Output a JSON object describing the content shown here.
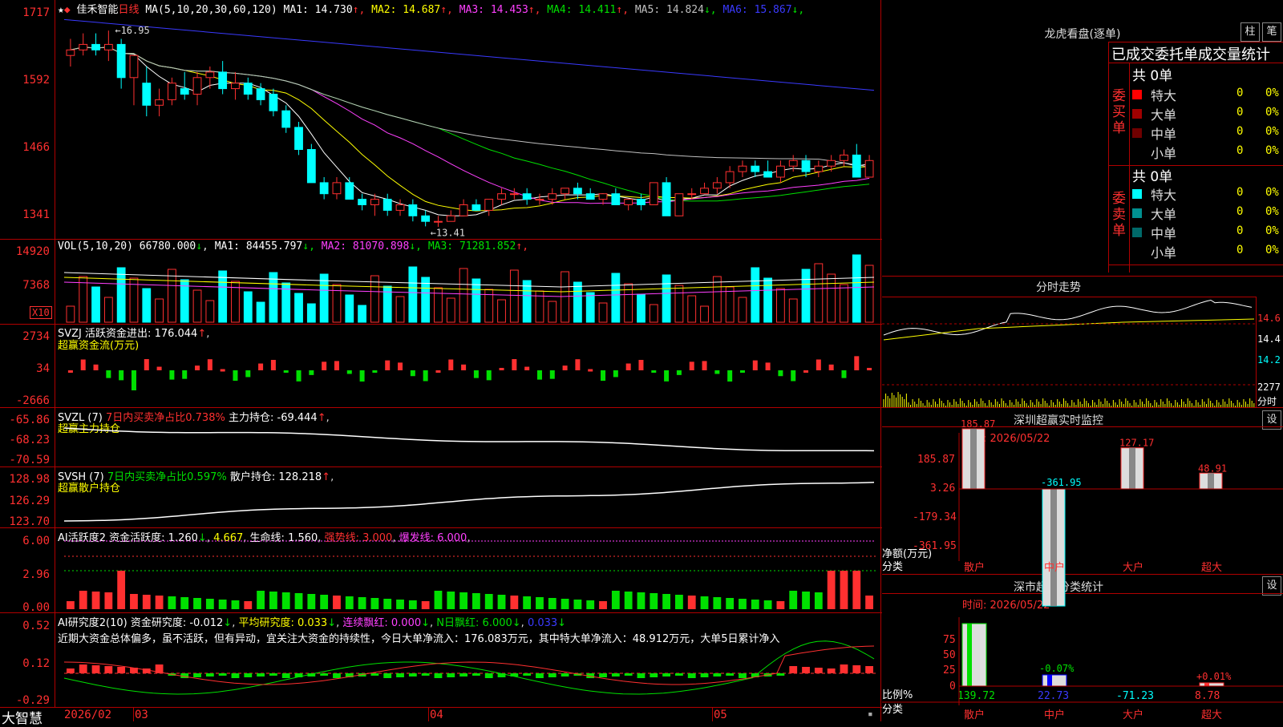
{
  "stock": {
    "name": "佳禾智能",
    "period": "日线",
    "ma_params": "MA(5,10,20,30,60,120)",
    "ma_values": [
      {
        "label": "MA1:",
        "value": "14.730",
        "arrow": "↑",
        "color": "#ffffff"
      },
      {
        "label": "MA2:",
        "value": "14.687",
        "arrow": "↑",
        "color": "#ffff00"
      },
      {
        "label": "MA3:",
        "value": "14.453",
        "arrow": "↑",
        "color": "#ff40ff"
      },
      {
        "label": "MA4:",
        "value": "14.411",
        "arrow": "↑",
        "color": "#00e000"
      },
      {
        "label": "MA5:",
        "value": "14.824",
        "arrow": "↓",
        "color": "#c0c0c0"
      },
      {
        "label": "MA6:",
        "value": "15.867",
        "arrow": "↓",
        "color": "#3a3aff"
      }
    ],
    "price_axis": [
      "1717",
      "1592",
      "1466",
      "1341"
    ],
    "high_label": "16.95",
    "low_label": "13.41"
  },
  "volume": {
    "header": "VOL(5,10,20)",
    "value": "66780.000",
    "arrow": "↓",
    "ma": [
      {
        "label": "MA1:",
        "value": "84455.797",
        "arrow": "↓",
        "color": "#ffffff"
      },
      {
        "label": "MA2:",
        "value": "81070.898",
        "arrow": "↓",
        "color": "#ff40ff"
      },
      {
        "label": "MA3:",
        "value": "71281.852",
        "arrow": "↑",
        "color": "#00e000"
      }
    ],
    "axis": [
      "14920",
      "7368"
    ],
    "unit": "X10"
  },
  "svzj": {
    "header": "SVZJ",
    "label": "活跃资金进出:",
    "value": "176.044",
    "arrow": "↑",
    "subtitle": "超赢资金流(万元)",
    "axis": [
      "2734",
      "34",
      "-2666"
    ]
  },
  "svzl": {
    "header": "SVZL (7)",
    "desc": "7日内买卖净占比0.738%",
    "label": "主力持仓:",
    "value": "-69.444",
    "arrow": "↑",
    "subtitle": "超赢主力持仓",
    "axis": [
      "-65.86",
      "-68.23",
      "-70.59"
    ]
  },
  "svsh": {
    "header": "SVSH (7)",
    "desc": "7日内买卖净占比0.597%",
    "label": "散户持仓:",
    "value": "128.218",
    "arrow": "↑",
    "subtitle": "超赢散户持仓",
    "axis": [
      "128.98",
      "126.29",
      "123.70"
    ]
  },
  "ai_active": {
    "header": "AI活跃度2",
    "label": "资金活跃度:",
    "value": "1.260",
    "arrow": "↓",
    "value2": "4.667",
    "life_label": "生命线:",
    "life_value": "1.560",
    "strong_label": "强势线:",
    "strong_value": "3.000",
    "burst_label": "爆发线:",
    "burst_value": "6.000",
    "axis": [
      "6.00",
      "2.96",
      "0.00"
    ]
  },
  "ai_research": {
    "header": "AI研究度2(10)",
    "label": "资金研究度:",
    "value": "-0.012",
    "avg_label": "平均研究度:",
    "avg_value": "0.033",
    "red_label": "连续飘红:",
    "red_value": "0.000",
    "nday_label": "N日飘红:",
    "nday_value": "6.000",
    "last_value": "0.033",
    "comment": "近期大资金总体偏多，虽不活跃，但有异动，宜关注大资金的持续性，今日大单净流入：176.083万元，其中特大单净流入：48.912万元，大单5日累计净入",
    "axis": [
      "0.52",
      "0.12",
      "-0.29"
    ]
  },
  "date_axis": {
    "brand": "大智慧",
    "labels": [
      "2026/02",
      "03",
      "04",
      "05"
    ]
  },
  "right_panel": {
    "dragon_title": "龙虎看盘(逐单)",
    "btn1": "柱",
    "btn2": "笔",
    "stats_title": "已成交委托单成交量统计",
    "buy_label": "委买单",
    "sell_label": "委卖单",
    "buy_total": "共 0单",
    "sell_total": "共 0单",
    "buy_rows": [
      {
        "name": "特大",
        "count": "0",
        "pct": "0%",
        "color": "#ff0000"
      },
      {
        "name": "大单",
        "count": "0",
        "pct": "0%",
        "color": "#a00000"
      },
      {
        "name": "中单",
        "count": "0",
        "pct": "0%",
        "color": "#700000"
      },
      {
        "name": "小单",
        "count": "0",
        "pct": "0%",
        "color": "#000000"
      }
    ],
    "sell_rows": [
      {
        "name": "特大",
        "count": "0",
        "pct": "0%",
        "color": "#00ffff"
      },
      {
        "name": "大单",
        "count": "0",
        "pct": "0%",
        "color": "#009090"
      },
      {
        "name": "中单",
        "count": "0",
        "pct": "0%",
        "color": "#006a6a"
      },
      {
        "name": "小单",
        "count": "0",
        "pct": "0%",
        "color": "#000000"
      }
    ],
    "intraday_title": "分时走势",
    "intraday_axis": [
      "14.6",
      "14.4",
      "14.2",
      "2277"
    ],
    "intraday_unit": "分时",
    "monitor_title": "深圳超赢实时监控",
    "monitor_btn": "设",
    "monitor_time": "时间: 2026/05/22",
    "monitor_axis": [
      "185.87",
      "3.26",
      "-179.34",
      "-361.95"
    ],
    "monitor_ylabel": "净额(万元)",
    "monitor_xlabel": "分类",
    "monitor_bars": [
      {
        "cat": "散户",
        "value": "185.87",
        "color": "#ff3030"
      },
      {
        "cat": "中户",
        "value": "-361.95",
        "color": "#00ffff"
      },
      {
        "cat": "大户",
        "value": "127.17",
        "color": "#ff3030"
      },
      {
        "cat": "超大",
        "value": "48.91",
        "color": "#ff3030"
      }
    ],
    "class_title": "深市超赢分类统计",
    "class_btn": "设",
    "class_time": "时间: 2026/05/22",
    "class_axis": [
      "75",
      "50",
      "25",
      "0"
    ],
    "class_ylabel": "比例%",
    "class_xlabel": "分类",
    "class_bars": [
      {
        "cat": "散户",
        "value": "139.72",
        "label": "",
        "color": "#00e000"
      },
      {
        "cat": "中户",
        "value": "22.73",
        "label": "-0.07%",
        "color": "#0000ff"
      },
      {
        "cat": "大户",
        "value": "-71.23",
        "label": "",
        "color": "#00ffff"
      },
      {
        "cat": "超大",
        "value": "8.78",
        "label": "+0.01%",
        "color": "#ff3030"
      }
    ]
  },
  "chart_data": {
    "type": "candlestick",
    "note_series": "daily OHLC approximated from chart",
    "candles": [
      [
        16.5,
        16.8,
        16.3,
        16.6
      ],
      [
        16.6,
        16.9,
        16.5,
        16.7
      ],
      [
        16.7,
        16.9,
        16.5,
        16.6
      ],
      [
        16.6,
        16.95,
        16.4,
        16.7
      ],
      [
        16.7,
        16.8,
        15.9,
        16.1
      ],
      [
        16.1,
        16.5,
        15.6,
        16.5
      ],
      [
        16.0,
        16.3,
        15.4,
        15.6
      ],
      [
        15.6,
        15.9,
        15.4,
        15.7
      ],
      [
        15.7,
        16.1,
        15.6,
        16.0
      ],
      [
        15.9,
        16.2,
        15.7,
        15.8
      ],
      [
        15.8,
        16.2,
        15.6,
        16.1
      ],
      [
        16.1,
        16.3,
        15.9,
        16.2
      ],
      [
        16.2,
        16.4,
        15.8,
        15.9
      ],
      [
        15.9,
        16.2,
        15.7,
        16.0
      ],
      [
        16.0,
        16.1,
        15.7,
        15.8
      ],
      [
        15.9,
        16.0,
        15.6,
        15.7
      ],
      [
        15.8,
        15.9,
        15.4,
        15.5
      ],
      [
        15.5,
        15.6,
        15.1,
        15.2
      ],
      [
        15.2,
        15.3,
        14.7,
        14.8
      ],
      [
        14.8,
        14.9,
        14.2,
        14.2
      ],
      [
        14.2,
        14.3,
        13.9,
        14.0
      ],
      [
        14.0,
        14.3,
        13.9,
        14.2
      ],
      [
        14.2,
        14.3,
        13.9,
        13.9
      ],
      [
        13.9,
        14.0,
        13.7,
        13.8
      ],
      [
        13.8,
        14.0,
        13.6,
        13.9
      ],
      [
        13.9,
        14.0,
        13.6,
        13.7
      ],
      [
        13.7,
        13.9,
        13.6,
        13.8
      ],
      [
        13.8,
        13.9,
        13.5,
        13.6
      ],
      [
        13.6,
        13.7,
        13.41,
        13.5
      ],
      [
        13.5,
        13.6,
        13.4,
        13.5
      ],
      [
        13.5,
        13.7,
        13.5,
        13.6
      ],
      [
        13.6,
        13.9,
        13.6,
        13.8
      ],
      [
        13.8,
        13.9,
        13.7,
        13.7
      ],
      [
        13.7,
        13.9,
        13.6,
        13.9
      ],
      [
        13.9,
        14.1,
        13.8,
        14.0
      ],
      [
        14.0,
        14.1,
        13.9,
        14.0
      ],
      [
        14.0,
        14.1,
        13.8,
        13.9
      ],
      [
        13.9,
        14.0,
        13.8,
        13.9
      ],
      [
        13.9,
        14.1,
        13.8,
        14.0
      ],
      [
        14.0,
        14.1,
        13.9,
        14.1
      ],
      [
        14.1,
        14.2,
        13.9,
        14.0
      ],
      [
        14.0,
        14.1,
        13.9,
        13.9
      ],
      [
        13.9,
        14.0,
        13.8,
        14.0
      ],
      [
        14.0,
        14.1,
        13.8,
        13.8
      ],
      [
        13.8,
        13.9,
        13.7,
        13.9
      ],
      [
        13.9,
        14.0,
        13.7,
        13.8
      ],
      [
        13.8,
        14.2,
        13.8,
        14.2
      ],
      [
        14.2,
        14.3,
        13.6,
        13.6
      ],
      [
        13.6,
        14.0,
        13.6,
        14.0
      ],
      [
        14.0,
        14.1,
        13.9,
        14.0
      ],
      [
        14.0,
        14.2,
        14.0,
        14.1
      ],
      [
        14.1,
        14.3,
        14.0,
        14.2
      ],
      [
        14.2,
        14.5,
        14.1,
        14.4
      ],
      [
        14.4,
        14.6,
        14.3,
        14.5
      ],
      [
        14.5,
        14.6,
        14.3,
        14.4
      ],
      [
        14.4,
        14.6,
        14.3,
        14.3
      ],
      [
        14.3,
        14.6,
        14.2,
        14.5
      ],
      [
        14.5,
        14.7,
        14.4,
        14.6
      ],
      [
        14.6,
        14.7,
        14.3,
        14.4
      ],
      [
        14.4,
        14.6,
        14.3,
        14.5
      ],
      [
        14.5,
        14.7,
        14.4,
        14.6
      ],
      [
        14.6,
        14.8,
        14.5,
        14.7
      ],
      [
        14.7,
        14.9,
        14.3,
        14.3
      ],
      [
        14.3,
        14.7,
        14.3,
        14.6
      ]
    ],
    "xlabels": [
      "2026/02",
      "03",
      "04",
      "05"
    ]
  }
}
